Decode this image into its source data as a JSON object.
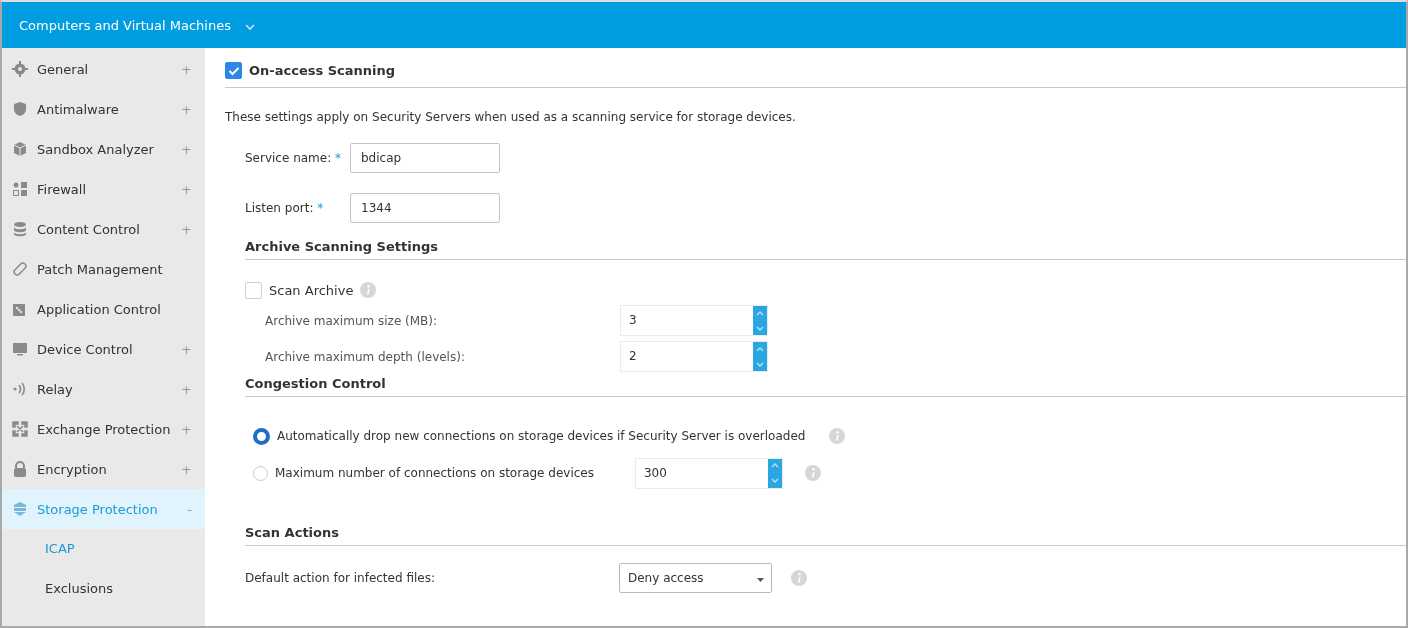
{
  "header": {
    "title": "Computers and Virtual Machines"
  },
  "sidebar": {
    "items": [
      {
        "label": "General",
        "toggle": "+",
        "selected": false
      },
      {
        "label": "Antimalware",
        "toggle": "+",
        "selected": false
      },
      {
        "label": "Sandbox Analyzer",
        "toggle": "+",
        "selected": false
      },
      {
        "label": "Firewall",
        "toggle": "+",
        "selected": false
      },
      {
        "label": "Content Control",
        "toggle": "+",
        "selected": false
      },
      {
        "label": "Patch Management",
        "selected": false
      },
      {
        "label": "Application Control",
        "selected": false
      },
      {
        "label": "Device Control",
        "toggle": "+",
        "selected": false
      },
      {
        "label": "Relay",
        "toggle": "+",
        "selected": false
      },
      {
        "label": "Exchange Protection",
        "toggle": "+",
        "selected": false
      },
      {
        "label": "Encryption",
        "toggle": "+",
        "selected": false
      },
      {
        "label": "Storage Protection",
        "toggle": "-",
        "selected": true,
        "children": [
          {
            "label": "ICAP",
            "selected": true
          },
          {
            "label": "Exclusions",
            "selected": false
          }
        ]
      }
    ]
  },
  "main": {
    "title": "On-access Scanning",
    "checked": true,
    "description": "These settings apply on Security Servers when used as a scanning service for storage devices.",
    "fields": [
      {
        "label": "Service name:",
        "required": "*",
        "value": "bdicap"
      },
      {
        "label": "Listen port:",
        "required": "*",
        "value": "1344"
      }
    ],
    "archive": {
      "title": "Archive Scanning Settings",
      "scan_label": "Scan Archive",
      "checked": false,
      "spinners": [
        {
          "label": "Archive maximum size (MB):",
          "value": "3"
        },
        {
          "label": "Archive maximum depth (levels):",
          "value": "2"
        }
      ]
    },
    "congestion": {
      "title": "Congestion Control",
      "options": [
        {
          "label": "Automatically drop new connections on storage devices if Security Server is overloaded",
          "selected": true
        },
        {
          "label": "Maximum number of connections on storage devices",
          "selected": false,
          "value": "300"
        }
      ]
    },
    "actions": {
      "title": "Scan Actions",
      "label": "Default action for infected files:",
      "value": "Deny access"
    }
  }
}
